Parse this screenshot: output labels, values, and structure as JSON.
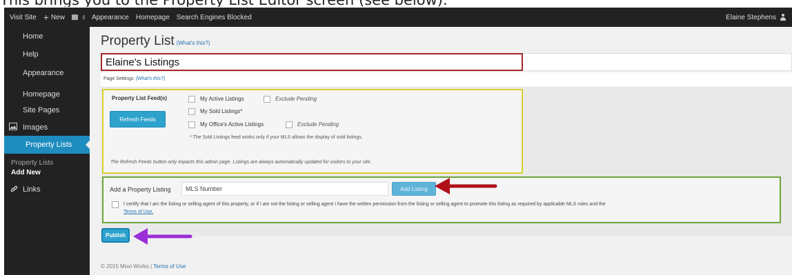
{
  "caption": "This brings you to the Property List Editor screen (see below).",
  "adminbar": {
    "visit_site": "Visit Site",
    "new_label": "New",
    "appearance": "Appearance",
    "homepage": "Homepage",
    "search_engines": "Search Engines Blocked",
    "user": "Elaine Stephens"
  },
  "sidebar": {
    "items": [
      {
        "label": "Home"
      },
      {
        "label": "Help"
      },
      {
        "label": "Appearance"
      },
      {
        "label": "Homepage"
      },
      {
        "label": "Site Pages"
      },
      {
        "label": "Images"
      },
      {
        "label": "Property Lists"
      }
    ],
    "sub_items": [
      {
        "label": "Property Lists"
      },
      {
        "label": "Add New"
      }
    ],
    "links": "Links"
  },
  "main": {
    "title": "Property List",
    "title_help": "(What's this?)",
    "list_title_value": "Elaine's Listings",
    "page_settings": "Page Settings",
    "page_settings_help": "(What's this?)",
    "feeds_label": "Property List Feed(s)",
    "refresh_button": "Refresh Feeds",
    "feeds": {
      "my_active": "My Active Listings",
      "exclude_pending_1": "Exclude Pending",
      "my_sold": "My Sold Listings*",
      "office_active": "My Office's Active Listings",
      "exclude_pending_2": "Exclude Pending"
    },
    "sold_note": "* The Sold Listings feed works only if your MLS allows the display of sold listings.",
    "refresh_note": "The Refresh Feeds button only impacts this admin page. Listings are always automatically updated for visitors to your site.",
    "add_listing_label": "Add a Property Listing",
    "mls_value": "MLS Number",
    "add_listing_button": "Add Listing",
    "certify_text": "I certify that I am the listing or selling agent of this property, or if I am not the listing or selling agent I have the written permission from the listing or selling agent to promote this listing as required by applicable MLS rules and the",
    "certify_link": "Terms of Use.",
    "publish_button": "Publish"
  },
  "footer": {
    "copyright": "© 2015 Moxi Works |",
    "terms": "Terms of Use"
  },
  "colors": {
    "highlight_red": "#a3262c",
    "highlight_yellow": "#d8d02a",
    "highlight_green": "#6ba539",
    "arrow_red": "#b0101a",
    "arrow_purple": "#9a2ed8",
    "accent_blue": "#2ea2cc",
    "admin_dark": "#222222"
  }
}
